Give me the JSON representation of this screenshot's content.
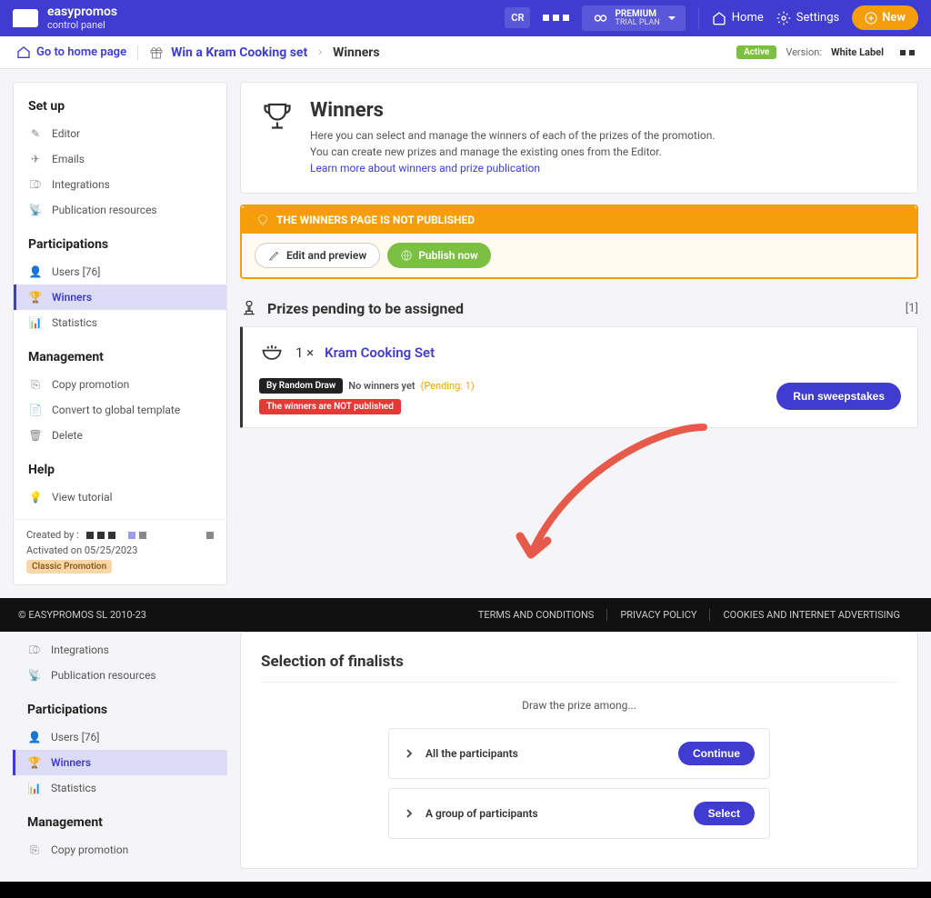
{
  "topbar": {
    "logo_title": "easypromos",
    "logo_sub": "control panel",
    "cr": "CR",
    "premium_title": "PREMIUM",
    "premium_sub": "TRIAL PLAN",
    "home": "Home",
    "settings": "Settings",
    "new": "New"
  },
  "breadcrumb": {
    "home": "Go to home page",
    "promo": "Win a Kram Cooking set",
    "current": "Winners",
    "active": "Active",
    "version_label": "Version:",
    "version_value": "White Label"
  },
  "sidebar": {
    "setup": "Set up",
    "editor": "Editor",
    "emails": "Emails",
    "integrations": "Integrations",
    "pub_resources": "Publication resources",
    "participations": "Participations",
    "users": "Users [76]",
    "winners": "Winners",
    "statistics": "Statistics",
    "management": "Management",
    "copy": "Copy promotion",
    "convert": "Convert to global template",
    "delete": "Delete",
    "help": "Help",
    "tutorial": "View tutorial",
    "created_by": "Created by :",
    "activated_on": "Activated on 05/25/2023",
    "classic": "Classic Promotion"
  },
  "winners_panel": {
    "title": "Winners",
    "desc1": "Here you can select and manage the winners of each of the prizes of the promotion.",
    "desc2": "You can create new prizes and manage the existing ones from the Editor.",
    "learn": "Learn more about winners and prize publication"
  },
  "warning": {
    "text": "THE WINNERS PAGE IS NOT PUBLISHED",
    "edit": "Edit and preview",
    "publish": "Publish now"
  },
  "prizes": {
    "title": "Prizes pending to be assigned",
    "count": "[1]",
    "qty": "1 ×",
    "name": "Kram Cooking Set",
    "tag_draw": "By Random Draw",
    "no_winners": "No winners yet",
    "pending": "(Pending: 1)",
    "not_published": "The winners are NOT published",
    "run": "Run sweepstakes"
  },
  "footer": {
    "copyright": "© EASYPROMOS SL 2010-23",
    "terms": "TERMS AND CONDITIONS",
    "privacy": "PRIVACY POLICY",
    "cookies": "COOKIES AND INTERNET ADVERTISING"
  },
  "selection": {
    "title": "Selection of finalists",
    "sub": "Draw the prize among...",
    "opt1": "All the participants",
    "opt2": "A group of participants",
    "continue": "Continue",
    "select": "Select"
  }
}
